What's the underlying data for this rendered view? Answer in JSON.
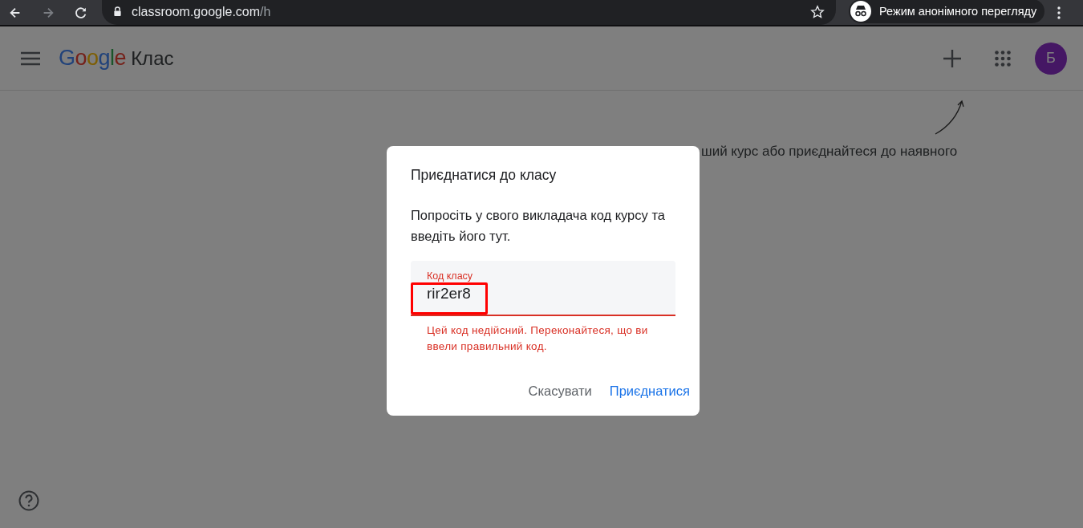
{
  "browser": {
    "url_host": "classroom.google.com",
    "url_path": "/h",
    "incognito_label": "Режим анонімного перегляду"
  },
  "app": {
    "logo": "Google",
    "product": "Клас",
    "avatar": "Б"
  },
  "background_text": "ший курс або приєднайтеся до наявного",
  "dialog": {
    "title": "Приєднатися до класу",
    "body": "Попросіть у свого викладача код курсу та введіть його тут.",
    "field": {
      "label": "Код класу",
      "value": "rir2er8",
      "invalid": true,
      "highlighted": true,
      "error": "Цей код недійсний. Переконайтеся, що ви ввели правильний код."
    },
    "buttons": [
      {
        "label": "Скасувати",
        "kind": "secondary"
      },
      {
        "label": "Приєднатися",
        "kind": "primary"
      }
    ]
  }
}
